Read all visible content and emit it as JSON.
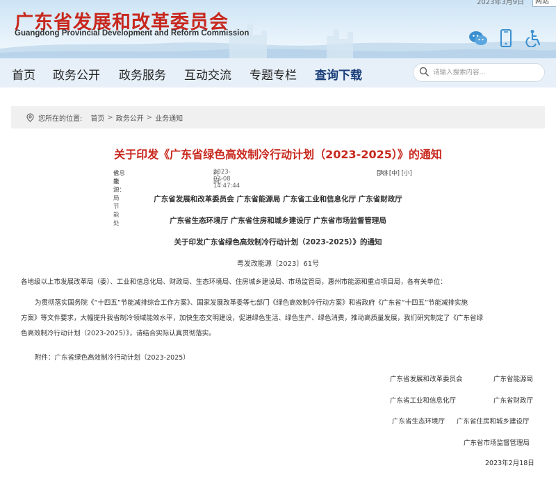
{
  "header": {
    "brand_cn": "广东省发展和改革委员会",
    "brand_en": "Guangdong Provincial Development and Reform Commission",
    "top_date": "2023年3月9日",
    "top_link": "网站",
    "icons": [
      "wechat-icon",
      "mobile-icon",
      "accessibility-icon"
    ],
    "brand_color": "#c8281e",
    "nav_accent": "#1a3e7a"
  },
  "nav": {
    "items": [
      {
        "label": "首页"
      },
      {
        "label": "政务公开"
      },
      {
        "label": "政务服务"
      },
      {
        "label": "互动交流"
      },
      {
        "label": "专题专栏"
      },
      {
        "label": "查询下载"
      }
    ],
    "active_index": 5
  },
  "search": {
    "placeholder": "请输入搜索内容..."
  },
  "breadcrumb": {
    "prefix": "您所在的位置:",
    "items": [
      "首页",
      "政务公开",
      "业务通知"
    ]
  },
  "article": {
    "title": "关于印发《广东省绿色高效制冷行动计划（2023-2025）》的通知",
    "source_label": "信息来源：",
    "source": "省能源局节能处",
    "time_label": "时间：",
    "time": "2023-03-08 14:47:44",
    "font_label": "字体：",
    "font_sizes": [
      "[大]",
      "[中]",
      "[小]"
    ],
    "issuers_line1": "广东省发展和改革委员会 广东省能源局 广东省工业和信息化厅 广东省财政厅",
    "issuers_line2": "广东省生态环境厅 广东省住房和城乡建设厅 广东省市场监督管理局",
    "notice_title": "关于印发广东省绿色高效制冷行动计划（2023-2025）》的通知",
    "doc_number": "粤发改能源〔2023〕61号",
    "addressee": "各地级以上市发展改革局（委）、工业和信息化局、财政局、生态环境局、住房城乡建设局、市场监管局，惠州市能源和重点项目局，各有关单位：",
    "body_lines": [
      "为贯彻落实国务院《“十四五”节能减排综合工作方案》、国家发展改革委等七部门《绿色高效制冷行动方案》和省政府《广东省“十四五”节能减排实施",
      "方案》等文件要求，大幅提升我省制冷领域能效水平，加快生态文明建设，促进绿色生活、绿色生产、绿色消费，推动高质量发展，我们研究制定了《广东省绿",
      "色高效制冷行动计划（2023-2025）》，请结合实际认真贯彻落实。"
    ],
    "attachment": "附件：广东省绿色高效制冷行动计划（2023-2025）",
    "signatories": [
      "广东省发展和改革委员会",
      "广东省能源局",
      "广东省工业和信息化厅",
      "广东省财政厅",
      "广东省生态环境厅",
      "广东省住房和城乡建设厅",
      "广东省市场监督管理局"
    ],
    "date": "2023年2月18日"
  }
}
